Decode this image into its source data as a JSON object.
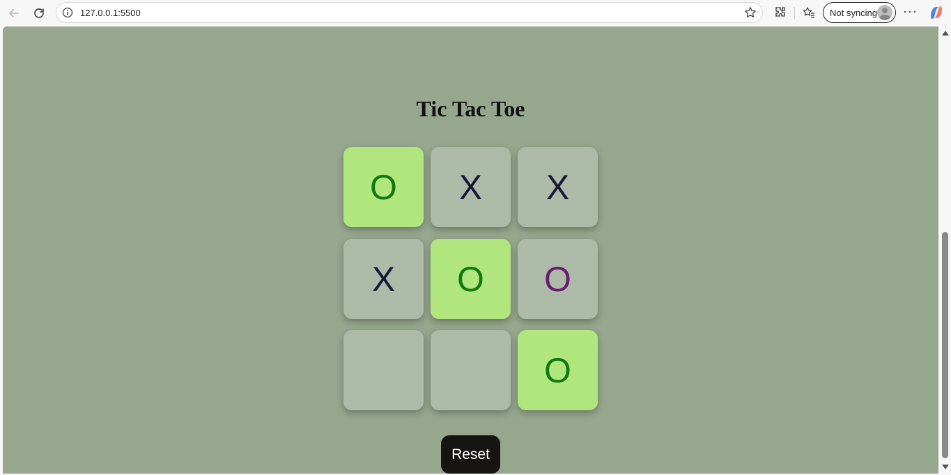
{
  "browser": {
    "url": "127.0.0.1:5500",
    "sync_label": "Not syncing",
    "more_label": "···"
  },
  "page": {
    "title": "Tic Tac Toe",
    "reset_label": "Reset",
    "background": "#96a78d"
  },
  "board": {
    "cells": [
      {
        "mark": "O",
        "color": "#0e7a0d",
        "highlight": true
      },
      {
        "mark": "X",
        "color": "#1a1638",
        "highlight": false
      },
      {
        "mark": "X",
        "color": "#1a1638",
        "highlight": false
      },
      {
        "mark": "X",
        "color": "#1a1638",
        "highlight": false
      },
      {
        "mark": "O",
        "color": "#0e7a0d",
        "highlight": true
      },
      {
        "mark": "O",
        "color": "#6a1b6e",
        "highlight": false
      },
      {
        "mark": "",
        "color": "#1a1638",
        "highlight": false
      },
      {
        "mark": "",
        "color": "#1a1638",
        "highlight": false
      },
      {
        "mark": "O",
        "color": "#0e7a0d",
        "highlight": true
      }
    ],
    "colors": {
      "cell": "#adbaa8",
      "winning_cell": "#b1e57d"
    }
  }
}
